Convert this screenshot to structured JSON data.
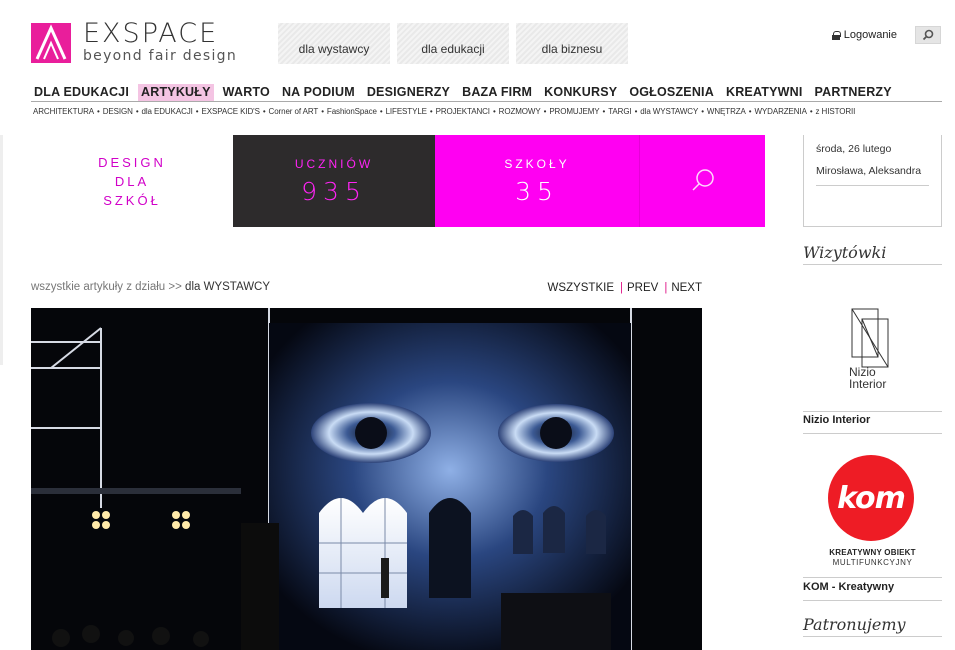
{
  "header": {
    "logo_title": "EXSPACE",
    "logo_subtitle": "beyond fair design",
    "top_tabs": [
      "dla wystawcy",
      "dla edukacji",
      "dla biznesu"
    ],
    "login_label": "Logowanie"
  },
  "main_nav": [
    {
      "label": "DLA EDUKACJI",
      "active": false
    },
    {
      "label": "ARTYKUŁY",
      "active": true
    },
    {
      "label": "WARTO",
      "active": false
    },
    {
      "label": "NA PODIUM",
      "active": false
    },
    {
      "label": "DESIGNERZY",
      "active": false
    },
    {
      "label": "BAZA FIRM",
      "active": false
    },
    {
      "label": "KONKURSY",
      "active": false
    },
    {
      "label": "OGŁOSZENIA",
      "active": false
    },
    {
      "label": "KREATYWNI",
      "active": false
    },
    {
      "label": "PARTNERZY",
      "active": false
    }
  ],
  "sub_nav": [
    "ARCHITEKTURA",
    "DESIGN",
    "dla EDUKACJI",
    "EXSPACE KID'S",
    "Corner of ART",
    "FashionSpace",
    "LIFESTYLE",
    "PROJEKTANCI",
    "ROZMOWY",
    "PROMUJEMY",
    "TARGI",
    "dla WYSTAWCY",
    "WNĘTRZA",
    "WYDARZENIA",
    "z HISTORII"
  ],
  "banner": {
    "left_lines": [
      "DESIGN",
      "DLA",
      "SZKÓŁ"
    ],
    "students_label": "UCZNIÓW",
    "students_count": "935",
    "schools_label": "SZKOŁY",
    "schools_count": "35",
    "colors": {
      "magenta": "#ff00f2",
      "dark": "#2d2b2c"
    }
  },
  "sidebar": {
    "date": "środa, 26 lutego",
    "names": "Mirosława, Aleksandra",
    "wizytowki_heading": "Wizytówki",
    "nizio_logo_line1": "Nizio",
    "nizio_logo_line2": "Interior",
    "nizio_caption": "Nizio Interior",
    "kom_logo": "kom",
    "kom_sub1": "KREATYWNY OBIEKT",
    "kom_sub2": "MULTIFUNKCYJNY",
    "kom_caption": "KOM - Kreatywny",
    "patronujemy_heading": "Patronujemy"
  },
  "content": {
    "breadcrumb_prefix": "wszystkie artykuły z działu >>",
    "breadcrumb_section": "dla WYSTAWCY",
    "pager": {
      "all": "WSZYSTKIE",
      "prev": "PREV",
      "next": "NEXT"
    },
    "photo_alt": "projection-mapping-stage-photo"
  }
}
